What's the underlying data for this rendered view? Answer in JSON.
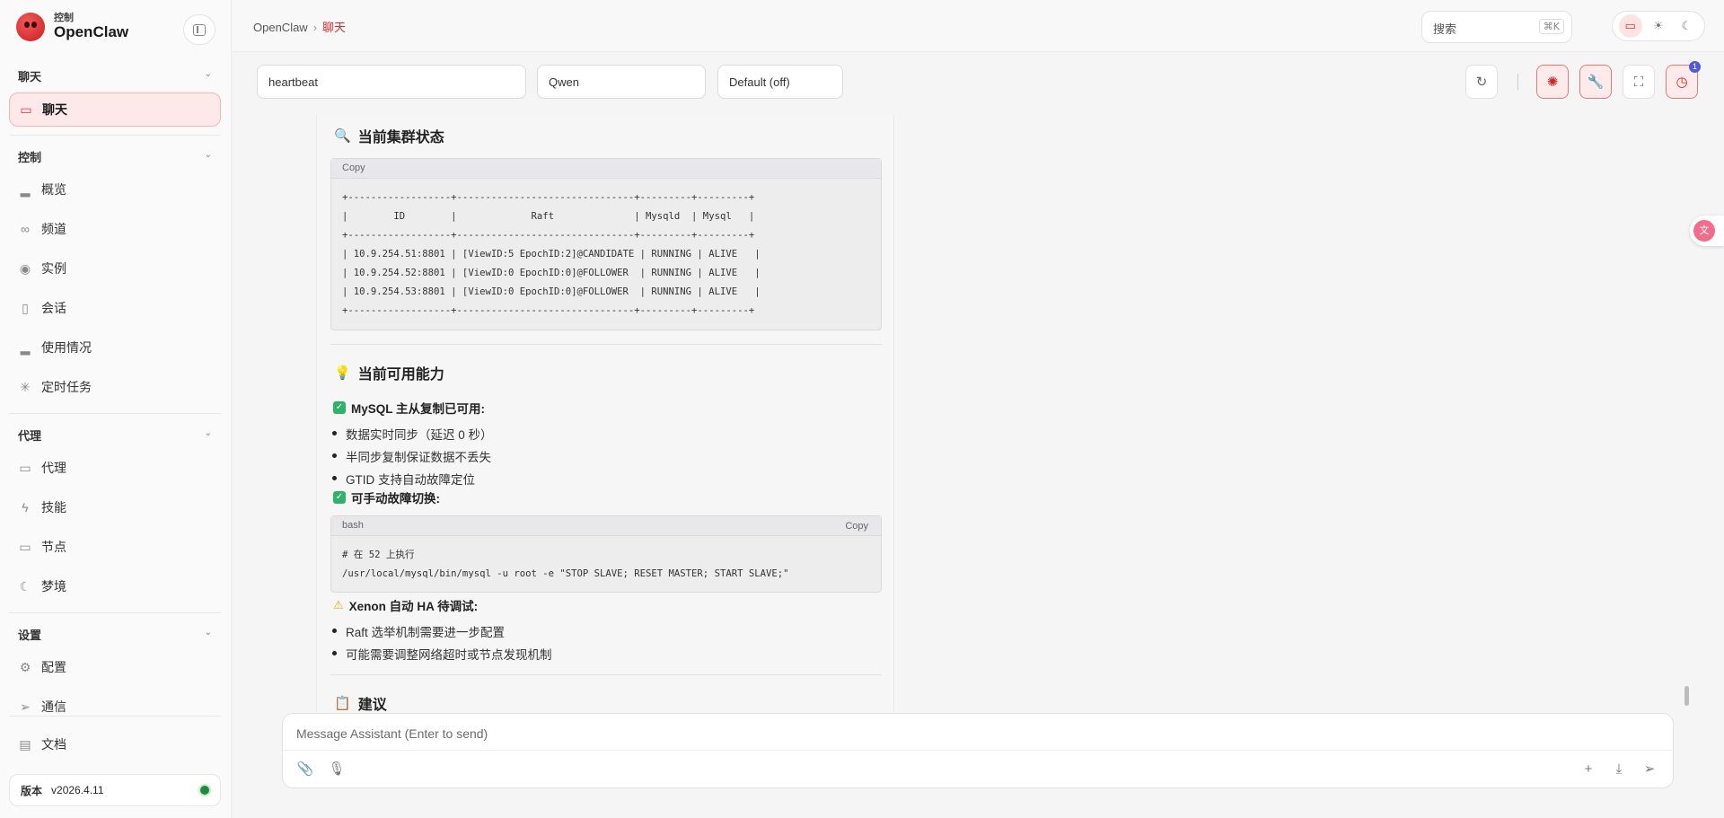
{
  "brand": {
    "subtitle": "控制",
    "name": "OpenClaw"
  },
  "sidebar": {
    "sections": [
      {
        "title": "聊天",
        "items": [
          {
            "label": "聊天",
            "icon": "message-icon",
            "active": true
          }
        ]
      },
      {
        "title": "控制",
        "items": [
          {
            "label": "概览",
            "icon": "bar-chart-icon"
          },
          {
            "label": "频道",
            "icon": "link-icon"
          },
          {
            "label": "实例",
            "icon": "radio-icon"
          },
          {
            "label": "会话",
            "icon": "file-icon"
          },
          {
            "label": "使用情况",
            "icon": "bar-chart-icon"
          },
          {
            "label": "定时任务",
            "icon": "loader-icon"
          }
        ]
      },
      {
        "title": "代理",
        "items": [
          {
            "label": "代理",
            "icon": "folder-icon"
          },
          {
            "label": "技能",
            "icon": "zap-icon"
          },
          {
            "label": "节点",
            "icon": "monitor-icon"
          },
          {
            "label": "梦境",
            "icon": "moon-icon"
          }
        ]
      },
      {
        "title": "设置",
        "items": [
          {
            "label": "配置",
            "icon": "gear-icon"
          },
          {
            "label": "通信",
            "icon": "send-icon"
          }
        ]
      }
    ],
    "docs_label": "文档",
    "version_label": "版本",
    "version_value": "v2026.4.11"
  },
  "header": {
    "breadcrumb_root": "OpenClaw",
    "breadcrumb_sep": "›",
    "breadcrumb_current": "聊天",
    "search_label": "搜索",
    "search_shortcut": "⌘K"
  },
  "filters": {
    "session": "heartbeat",
    "model": "Qwen",
    "thinking": "Default (off)",
    "notification_count": "1"
  },
  "message": {
    "cluster_heading": "当前集群状态",
    "cluster_copy": "Copy",
    "cluster_table": "+------------------+-------------------------------+---------+---------+\n|        ID        |             Raft              | Mysqld  | Mysql   |\n+------------------+-------------------------------+---------+---------+\n| 10.9.254.51:8801 | [ViewID:5 EpochID:2]@CANDIDATE | RUNNING | ALIVE   |\n| 10.9.254.52:8801 | [ViewID:0 EpochID:0]@FOLLOWER  | RUNNING | ALIVE   |\n| 10.9.254.53:8801 | [ViewID:0 EpochID:0]@FOLLOWER  | RUNNING | ALIVE   |\n+------------------+-------------------------------+---------+---------+",
    "capability_heading": "当前可用能力",
    "check1": "MySQL 主从复制已可用:",
    "check1_items": [
      "数据实时同步（延迟 0 秒）",
      "半同步复制保证数据不丢失",
      "GTID 支持自动故障定位"
    ],
    "check2": "可手动故障切换:",
    "bash_lang": "bash",
    "bash_copy": "Copy",
    "bash_code": "# 在 52 上执行\n/usr/local/mysql/bin/mysql -u root -e \"STOP SLAVE; RESET MASTER; START SLAVE;\"",
    "warn": "Xenon 自动 HA 待调试:",
    "warn_items": [
      "Raft 选举机制需要进一步配置",
      "可能需要调整网络超时或节点发现机制"
    ],
    "suggest_heading": "建议"
  },
  "composer": {
    "placeholder": "Message Assistant (Enter to send)"
  },
  "colors": {
    "accent": "#d02c2c",
    "accent_bg": "#fde9e9",
    "status_ok": "#1f8b3a",
    "check": "#2fb36a"
  }
}
